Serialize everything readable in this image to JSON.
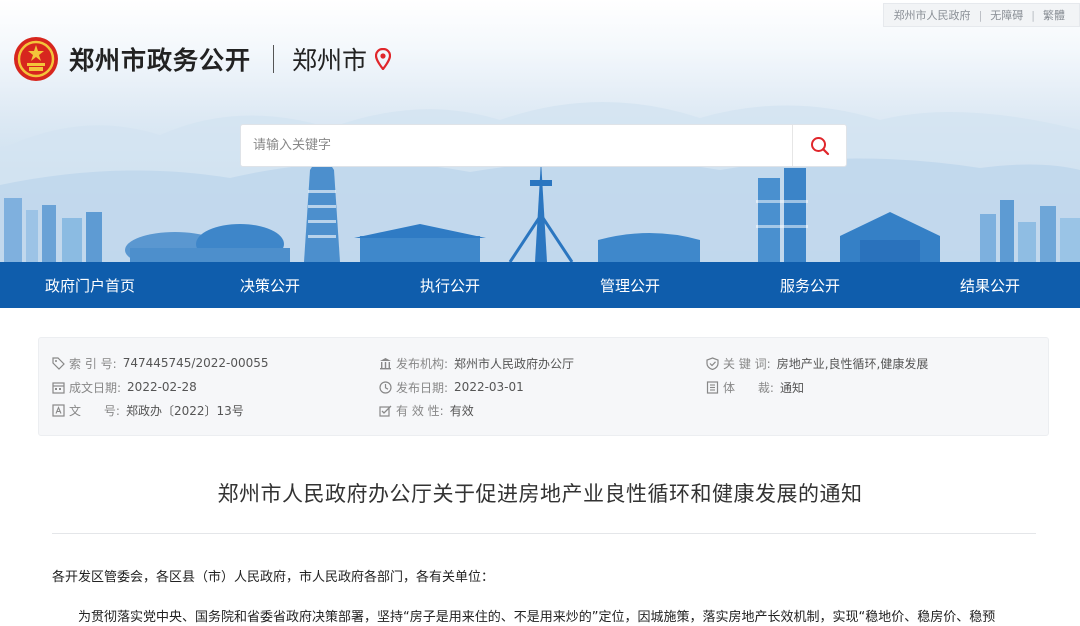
{
  "util_links": [
    "郑州市人民政府",
    "无障碍",
    "繁體"
  ],
  "site": {
    "title": "郑州市政务公开",
    "city": "郑州市"
  },
  "search": {
    "placeholder": "请输入关键字",
    "value": ""
  },
  "nav": [
    "政府门户首页",
    "决策公开",
    "执行公开",
    "管理公开",
    "服务公开",
    "结果公开"
  ],
  "meta": {
    "index_no": {
      "label": "索 引 号:",
      "value": "747445745/2022-00055"
    },
    "org": {
      "label": "发布机构:",
      "value": "郑州市人民政府办公厅"
    },
    "keywords": {
      "label": "关 键 词:",
      "value": "房地产业,良性循环,健康发展"
    },
    "written_date": {
      "label": "成文日期:",
      "value": "2022-02-28"
    },
    "publish_date": {
      "label": "发布日期:",
      "value": "2022-03-01"
    },
    "genre": {
      "label": "体      裁:",
      "value": "通知"
    },
    "doc_no": {
      "label": "文      号:",
      "value": "郑政办〔2022〕13号"
    },
    "validity": {
      "label": "有 效 性:",
      "value": "有效"
    }
  },
  "article": {
    "title": "郑州市人民政府办公厅关于促进房地产业良性循环和健康发展的通知",
    "salutation": "各开发区管委会，各区县（市）人民政府，市人民政府各部门，各有关单位：",
    "paragraph_1": "为贯彻落实党中央、国务院和省委省政府决策部署，坚持“房子是用来住的、不是用来炒的”定位，因城施策，落实房地产长效机制，实现“稳地价、稳房价、稳预"
  },
  "colors": {
    "nav_bg": "#0f5dac",
    "accent_red": "#e0262b",
    "meta_bg": "#f6f7f9"
  },
  "icons": {
    "emblem": "national-emblem-icon",
    "pin": "location-pin-icon",
    "search": "search-icon"
  }
}
